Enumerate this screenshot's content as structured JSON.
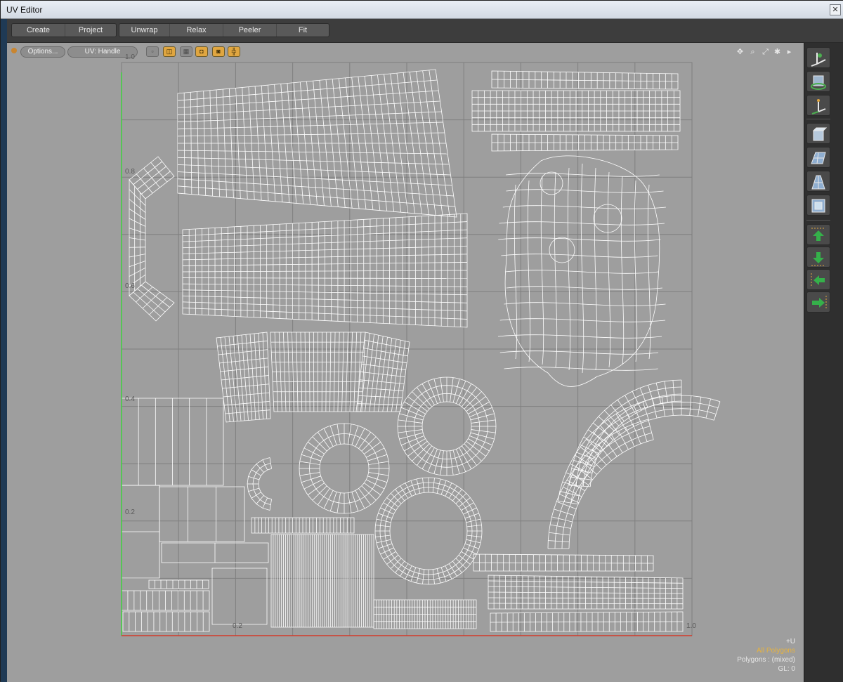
{
  "window": {
    "title": "UV Editor",
    "close_glyph": "✕"
  },
  "toolbar": {
    "group1": [
      "Create",
      "Project"
    ],
    "group2": [
      "Unwrap",
      "Relax",
      "Peeler",
      "Fit"
    ]
  },
  "options_row": {
    "options_label": "Options...",
    "uv_label": "UV: Handle",
    "selection_modes": [
      {
        "icon": "vertex-mode-icon",
        "active": false
      },
      {
        "icon": "edge-mode-icon",
        "active": true
      },
      {
        "icon": "polygon-mode-icon",
        "active": false
      },
      {
        "icon": "item-mode-icon",
        "active": true
      },
      {
        "icon": "island-mode-icon",
        "active": true
      },
      {
        "icon": "material-mode-icon",
        "active": true
      }
    ],
    "nav_icons": [
      "move-view-icon",
      "zoom-view-icon",
      "fit-view-icon",
      "settings-icon",
      "expand-arrow-icon"
    ]
  },
  "axes": {
    "v_labels": [
      "1.0",
      "0.8",
      "0.6",
      "0.4",
      "0.2"
    ],
    "u_labels": [
      "0.2",
      "1.0"
    ],
    "u_axis_marker": "+U"
  },
  "status": {
    "selection": "All Polygons",
    "polygons": "Polygons : (mixed)",
    "gl": "GL: 0"
  },
  "right_tools": [
    "transform-tool-icon",
    "rotate-tool-icon",
    "axis-tool-icon",
    "cube-view-icon",
    "grid-plane-icon",
    "perspective-plane-icon",
    "box-select-icon",
    "move-up-icon",
    "move-down-icon",
    "move-left-icon",
    "move-right-icon"
  ],
  "colors": {
    "viewport_bg": "#9e9e9e",
    "grid": "#7f7f7f",
    "mesh": "#ffffff",
    "v_axis": "#3fd13f",
    "u_axis": "#d43a2a",
    "accent": "#e0a640"
  }
}
